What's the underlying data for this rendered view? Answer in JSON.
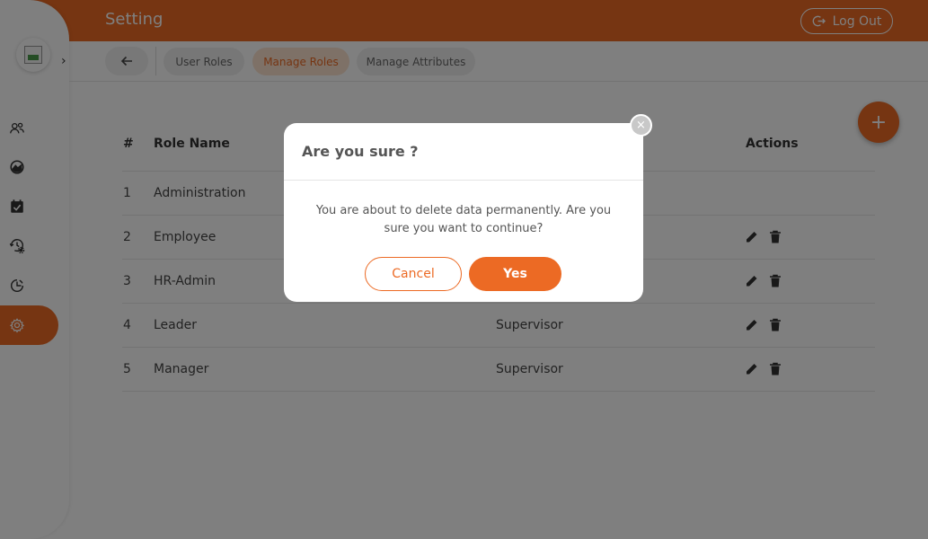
{
  "header": {
    "title": "Setting",
    "logout_label": "Log Out"
  },
  "tabs": [
    {
      "label": "User Roles",
      "active": false
    },
    {
      "label": "Manage Roles",
      "active": true
    },
    {
      "label": "Manage Attributes",
      "active": false
    }
  ],
  "table": {
    "columns": [
      "#",
      "Role Name",
      "Actions"
    ],
    "rows": [
      {
        "num": "1",
        "name": "Administration",
        "type": ""
      },
      {
        "num": "2",
        "name": "Employee",
        "type": ""
      },
      {
        "num": "3",
        "name": "HR-Admin",
        "type": ""
      },
      {
        "num": "4",
        "name": "Leader",
        "type": "Supervisor"
      },
      {
        "num": "5",
        "name": "Manager",
        "type": "Supervisor"
      }
    ]
  },
  "fab": {
    "label": "+"
  },
  "modal": {
    "title": "Are you sure ?",
    "message": "You are about to delete data permanently. Are you sure you want to continue?",
    "cancel_label": "Cancel",
    "yes_label": "Yes",
    "close_label": "×"
  },
  "colors": {
    "accent": "#ec6a24",
    "accent_light": "#fde3cf"
  }
}
